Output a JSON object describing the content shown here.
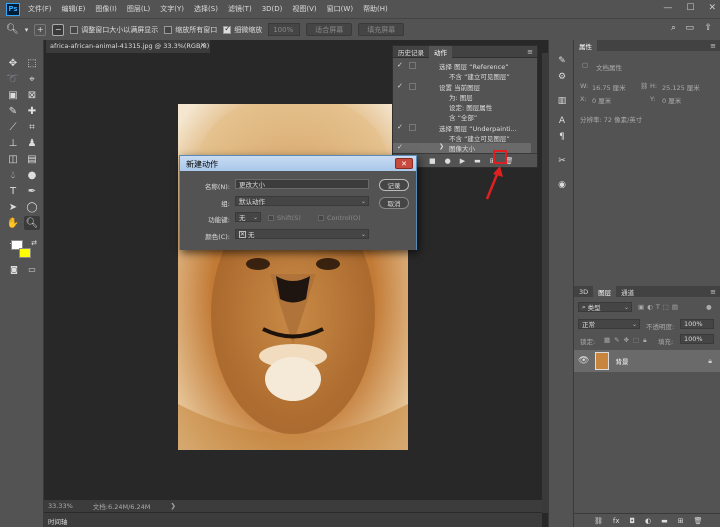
{
  "menubar": {
    "logo": "Ps",
    "items": [
      "文件(F)",
      "编辑(E)",
      "图像(I)",
      "图层(L)",
      "文字(Y)",
      "选择(S)",
      "滤镜(T)",
      "3D(D)",
      "视图(V)",
      "窗口(W)",
      "帮助(H)"
    ],
    "min": "—",
    "max": "☐",
    "close": "✕"
  },
  "options": {
    "resize_window": "调整窗口大小以满屏显示",
    "zoom_all": "缩放所有窗口",
    "scrubby_zoom": "细微缩放",
    "zoom_pct": "100%",
    "fit_screen": "适合屏幕",
    "fill_screen": "填充屏幕"
  },
  "document": {
    "tab_title": "africa-african-animal-41315.jpg @ 33.3%(RGB/8)",
    "zoom": "33.33%",
    "doc_size": "文档:6.24M/6.24M",
    "timeline": "时间轴"
  },
  "actions_panel": {
    "tabs": [
      "历史记录",
      "动作"
    ],
    "rows": [
      {
        "check": "✓",
        "text": "选择 图层 “Reference”"
      },
      {
        "check": "",
        "text": "不含 “建立可见图层”"
      },
      {
        "check": "✓",
        "text": "设置 当前图层"
      },
      {
        "check": "",
        "text": "为: 图层"
      },
      {
        "check": "",
        "text": "设定: 图层属性"
      },
      {
        "check": "",
        "text": "含 “全部”"
      },
      {
        "check": "✓",
        "text": "选择 图层 “Underpainti..."
      },
      {
        "check": "",
        "text": "不含 “建立可见图层”"
      },
      {
        "check": "✓",
        "text": "图像大小"
      }
    ]
  },
  "dialog": {
    "title": "新建动作",
    "name_label": "名称(N):",
    "name_value": "更改大小",
    "set_label": "组:",
    "set_value": "默认动作",
    "fkey_label": "功能键:",
    "fkey_value": "无",
    "shift_label": "Shift(S)",
    "control_label": "Control(O)",
    "color_label": "颜色(C):",
    "color_value": "无",
    "record_btn": "记录",
    "cancel_btn": "取消"
  },
  "properties": {
    "tab": "属性",
    "doc_props": "文档属性",
    "w_label": "W:",
    "w_value": "16.75 厘米",
    "h_label": "H:",
    "h_value": "25.125 厘米",
    "x_label": "X:",
    "x_value": "0 厘米",
    "y_label": "Y:",
    "y_value": "0 厘米",
    "resolution": "分辨率: 72 像素/英寸"
  },
  "layers": {
    "tabs": [
      "3D",
      "图层",
      "通道"
    ],
    "kind": "类型",
    "blend": "正常",
    "opacity_label": "不透明度:",
    "opacity": "100%",
    "lock_label": "锁定:",
    "fill_label": "填充:",
    "fill": "100%",
    "layer_name": "背景"
  },
  "colors": {
    "accent_red": "#e02020",
    "fg": "#ffffff",
    "bg": "#ffff00"
  }
}
